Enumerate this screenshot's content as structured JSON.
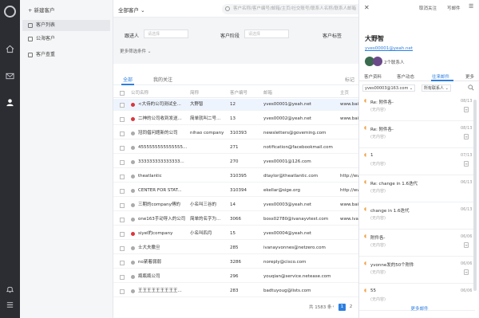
{
  "nav": {
    "new_customer": "+ 新建客户",
    "items": [
      "客户列表",
      "公海客户",
      "客户查重"
    ]
  },
  "main": {
    "scope": "全部客户",
    "search_placeholder": "客户名称/客户编号/邮箱/主页/社交账号/联系人名称/联系人邮箱",
    "filter": {
      "owner_label": "跟进人",
      "owner_placeholder": "请选择",
      "stage_label": "客户阶段",
      "stage_placeholder": "请选择",
      "tag_label": "客户标签",
      "more": "更多筛选条件"
    },
    "tabs": [
      "全部",
      "我的关注"
    ],
    "tabs_right": "标记",
    "columns": [
      "公司名称",
      "简称",
      "客户编号",
      "邮箱",
      "主页"
    ],
    "rows": [
      {
        "name": "<大侍的公司测试全...",
        "short": "大野智",
        "no": "12",
        "email": "yves00001@yeah.net",
        "home": "www.bai",
        "dot": "#d9363e",
        "hl": true
      },
      {
        "name": "二神的公司收到发送...",
        "short": "简单就叫二号...",
        "no": "13",
        "email": "yves00002@yeah.net",
        "home": "www.bai",
        "dot": "#d9363e",
        "hl": false
      },
      {
        "name": "冠同倡问题新的公司",
        "short": "nihao company",
        "no": "310393",
        "email": "newsletters@goveming.com",
        "home": "",
        "dot": "#aaaaaa",
        "hl": false
      },
      {
        "name": "4555555555555555...",
        "short": "",
        "no": "271",
        "email": "notification@facebookmail.com",
        "home": "",
        "dot": "#aaaaaa",
        "hl": false
      },
      {
        "name": "333333333333333...",
        "short": "",
        "no": "270",
        "email": "yves00001@126.com",
        "home": "",
        "dot": "#aaaaaa",
        "hl": false
      },
      {
        "name": "theatlantic",
        "short": "",
        "no": "310395",
        "email": "dtaylor@theatlantic.com",
        "home": "http://ww",
        "dot": "#aaaaaa",
        "hl": false
      },
      {
        "name": "CENTER FOR STAT...",
        "short": "",
        "no": "310394",
        "email": "ekellar@sige.org",
        "home": "http://ww",
        "dot": "#aaaaaa",
        "hl": false
      },
      {
        "name": "三期的company傅的",
        "short": "小名叫三谷的",
        "no": "14",
        "email": "yves00003@yeah.net",
        "home": "www.bai",
        "dot": "#aaaaaa",
        "hl": false
      },
      {
        "name": "one163手动导入的公司",
        "short": "简单的名字为...",
        "no": "3066",
        "email": "boss02780@ivanayvtest.com",
        "home": "www.iva",
        "dot": "#aaaaaa",
        "hl": false
      },
      {
        "name": "siyel的company",
        "short": "小名叫四月",
        "no": "15",
        "email": "yves00004@yeah.net",
        "home": "",
        "dot": "#d9363e",
        "hl": false
      },
      {
        "name": "士大夫撒旦",
        "short": "",
        "no": "285",
        "email": "ivanayvonnes@netzero.com",
        "home": "",
        "dot": "#aaaaaa",
        "hl": false
      },
      {
        "name": "no紧着弱弱",
        "short": "",
        "no": "3286",
        "email": "noreply@cisco.com",
        "home": "",
        "dot": "#aaaaaa",
        "hl": false
      },
      {
        "name": "瓶瓶瓶公司",
        "short": "",
        "no": "296",
        "email": "youqian@service.netease.com",
        "home": "",
        "dot": "#aaaaaa",
        "hl": false
      },
      {
        "name": "王王王王王王王王王...",
        "short": "",
        "no": "283",
        "email": "badtuyoug@lists.com",
        "home": "",
        "dot": "#aaaaaa",
        "hl": false
      }
    ],
    "pager": {
      "total": "共 1583 条",
      "pages": [
        "1",
        "2",
        "3"
      ]
    }
  },
  "panel": {
    "close": "✕",
    "unfollow": "取消关注",
    "write_mail": "写邮件",
    "menu": "☰",
    "name": "大野智",
    "email": "yves00001@yeah.net",
    "contacts": "2个联系人",
    "tabs": [
      "客户资料",
      "客户动态",
      "往来邮件",
      "更多"
    ],
    "mail_account": "yves00003@163.com",
    "contact_filter": "所有联系人",
    "mails": [
      {
        "title": "Re: 附件各-",
        "sub": "(无内容)",
        "date": "08/13",
        "att": true
      },
      {
        "title": "Re: 附件各-",
        "sub": "(无内容)",
        "date": "08/13",
        "att": true
      },
      {
        "title": "1",
        "sub": "(无内容)",
        "date": "07/13",
        "att": true
      },
      {
        "title": "Re: change in 1.6迭代",
        "sub": "(无内容)",
        "date": "06/13",
        "att": false
      },
      {
        "title": "change in 1.6迭代",
        "sub": "(无内容)",
        "date": "06/13",
        "att": false
      },
      {
        "title": "附件各-",
        "sub": "(无内容)",
        "date": "06/06",
        "att": true
      },
      {
        "title": "yvonne发的50个附件",
        "sub": "(无内容)",
        "date": "06/06",
        "att": true
      },
      {
        "title": "55",
        "sub": "(无内容)",
        "date": "06/06",
        "att": false
      }
    ],
    "load_more": "更多邮件"
  }
}
